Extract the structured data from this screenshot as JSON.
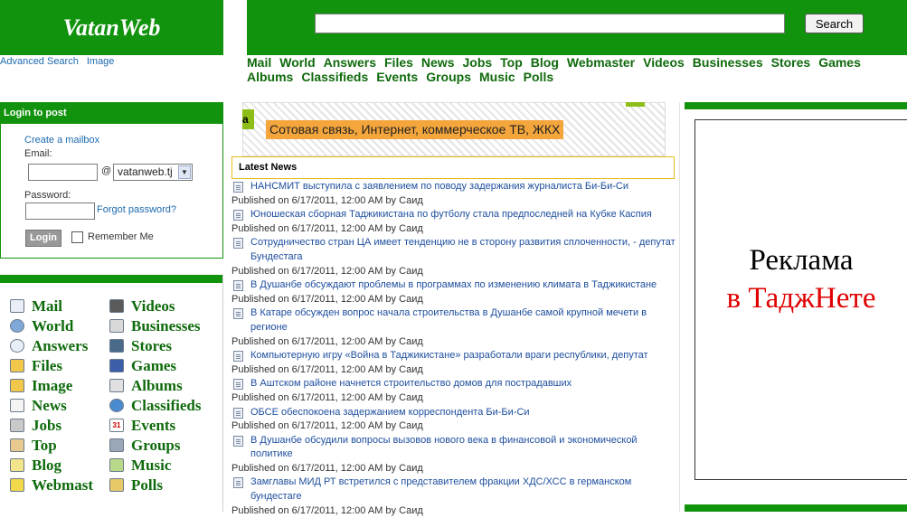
{
  "brand": {
    "logo": "VatanWeb",
    "green": "#12930e",
    "link_green": "#0f6a0c"
  },
  "header": {
    "links": [
      "Advanced Search",
      "Image"
    ],
    "search_button": "Search"
  },
  "topnav": {
    "row1": [
      "Mail",
      "World",
      "Answers",
      "Files",
      "News",
      "Jobs",
      "Top",
      "Blog",
      "Webmaster",
      "Videos",
      "Businesses",
      "Stores",
      "Games"
    ],
    "row2": [
      "Albums",
      "Classifieds",
      "Events",
      "Groups",
      "Music",
      "Polls"
    ]
  },
  "login": {
    "title": "Login to post",
    "create_mailbox": "Create a mailbox",
    "email_label": "Email:",
    "at": "@",
    "domain": "vatanweb.tj",
    "password_label": "Password:",
    "forgot": "Forgot password?",
    "login_button": "Login",
    "remember": "Remember Me"
  },
  "services": {
    "left": [
      {
        "label": "Mail",
        "icon": "mail-icon"
      },
      {
        "label": "World",
        "icon": "globe-icon"
      },
      {
        "label": "Answers",
        "icon": "answers-icon"
      },
      {
        "label": "Files",
        "icon": "folder-icon"
      },
      {
        "label": "Image",
        "icon": "image-icon"
      },
      {
        "label": "News",
        "icon": "newspaper-icon"
      },
      {
        "label": "Jobs",
        "icon": "tools-icon"
      },
      {
        "label": "Top",
        "icon": "top-icon"
      },
      {
        "label": "Blog",
        "icon": "blog-icon"
      },
      {
        "label": "Webmast",
        "icon": "pen-icon"
      }
    ],
    "right": [
      {
        "label": "Videos",
        "icon": "film-icon"
      },
      {
        "label": "Businesses",
        "icon": "building-icon"
      },
      {
        "label": "Stores",
        "icon": "cart-icon"
      },
      {
        "label": "Games",
        "icon": "gamepad-icon"
      },
      {
        "label": "Albums",
        "icon": "album-icon"
      },
      {
        "label": "Classifieds",
        "icon": "classifieds-icon"
      },
      {
        "label": "Events",
        "icon": "calendar-icon"
      },
      {
        "label": "Groups",
        "icon": "groups-icon"
      },
      {
        "label": "Music",
        "icon": "music-icon"
      },
      {
        "label": "Polls",
        "icon": "polls-icon"
      }
    ],
    "calendar_day": "31"
  },
  "banner": {
    "tab": "a",
    "text": "Сотовая связь, Интернет, коммерческое ТВ, ЖКХ"
  },
  "news": {
    "title": "Latest News",
    "items": [
      {
        "title": "НАНСМИТ выступила с заявлением по поводу задержания журналиста Би-Би-Си",
        "meta": "Published on 6/17/2011, 12:00 AM by Саид"
      },
      {
        "title": "Юношеская сборная Таджикистана по футболу стала предпоследней на Кубке Каспия",
        "meta": "Published on 6/17/2011, 12:00 AM by Саид"
      },
      {
        "title": "Сотрудничество стран ЦА имеет тенденцию не в сторону развития сплоченности, - депутат Бундестага",
        "meta": "Published on 6/17/2011, 12:00 AM by Саид"
      },
      {
        "title": "В Душанбе обсуждают проблемы в программах по изменению климата в Таджикистане",
        "meta": "Published on 6/17/2011, 12:00 AM by Саид"
      },
      {
        "title": "В Катаре обсужден вопрос начала строительства в Душанбе самой крупной мечети в регионе",
        "meta": "Published on 6/17/2011, 12:00 AM by Саид"
      },
      {
        "title": "Компьютерную игру «Война в Таджикистане» разработали враги республики, депутат",
        "meta": "Published on 6/17/2011, 12:00 AM by Саид"
      },
      {
        "title": "В Аштском районе начнется строительство домов для пострадавших",
        "meta": "Published on 6/17/2011, 12:00 AM by Саид"
      },
      {
        "title": "ОБСЕ обеспокоена задержанием корреспондента Би-Би-Си",
        "meta": "Published on 6/17/2011, 12:00 AM by Саид"
      },
      {
        "title": "В Душанбе обсудили вопросы вызовов нового века в финансовой и экономической политике",
        "meta": "Published on 6/17/2011, 12:00 AM by Саид"
      },
      {
        "title": "Замглавы МИД РТ встретился с представителем фракции ХДС/ХСС в германском бундестаге",
        "meta": "Published on 6/17/2011, 12:00 AM by Саид"
      }
    ]
  },
  "ad": {
    "line1": "Реклама",
    "line2": "в ТаджНете",
    "line2_color": "#e00000"
  }
}
